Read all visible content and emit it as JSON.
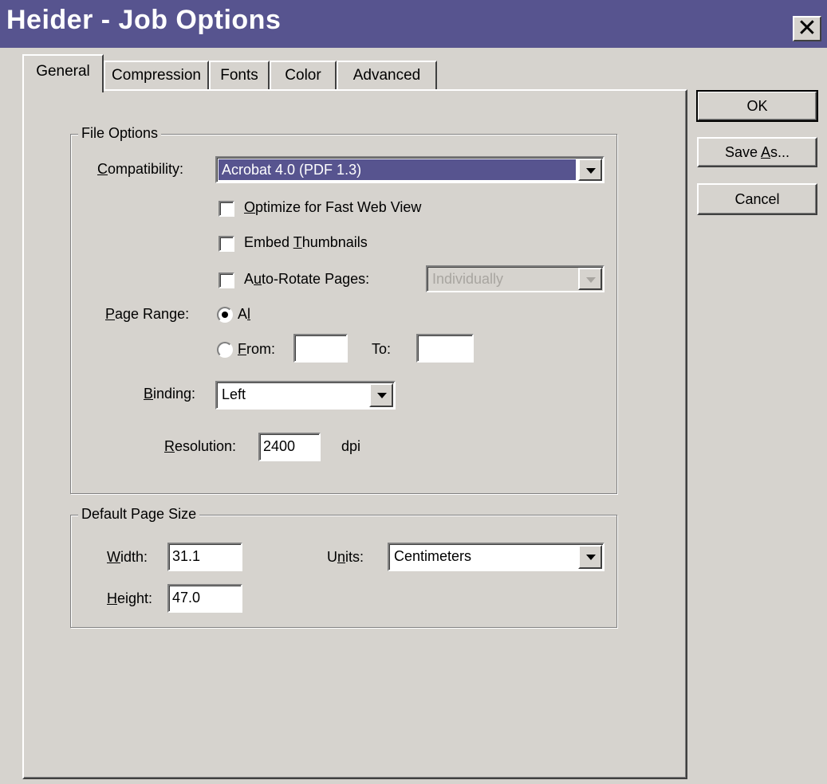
{
  "window": {
    "title": "Heider - Job Options",
    "close_glyph": "✕"
  },
  "tabs": [
    {
      "label": "General",
      "active": true
    },
    {
      "label": "Compression",
      "active": false
    },
    {
      "label": "Fonts",
      "active": false
    },
    {
      "label": "Color",
      "active": false
    },
    {
      "label": "Advanced",
      "active": false
    }
  ],
  "file_options": {
    "legend": "File Options",
    "compatibility": {
      "label_mnemonic": "C",
      "label_rest": "ompatibility:",
      "value": "Acrobat 4.0 (PDF 1.3)"
    },
    "optimize": {
      "checked": false,
      "label_mnemonic": "O",
      "label_rest": "ptimize for Fast Web View"
    },
    "thumbnails": {
      "checked": false,
      "label_pre": "Embed ",
      "label_mnemonic": "T",
      "label_rest": "humbnails"
    },
    "auto_rotate": {
      "checked": false,
      "label_pre": "A",
      "label_mnemonic": "u",
      "label_rest": "to-Rotate Pages:",
      "value": "Individually",
      "enabled": false
    },
    "page_range": {
      "label_mnemonic": "P",
      "label_rest": "age Range:",
      "all": {
        "selected": true,
        "label_pre": "A",
        "label_mnemonic": "l",
        "label_rest": "l"
      },
      "from": {
        "selected": false,
        "label_mnemonic": "F",
        "label_rest": "rom:",
        "value": ""
      },
      "to": {
        "label": "To:",
        "value": ""
      }
    },
    "binding": {
      "label_mnemonic": "B",
      "label_rest": "inding:",
      "value": "Left"
    },
    "resolution": {
      "label_mnemonic": "R",
      "label_rest": "esolution:",
      "value": "2400",
      "unit": "dpi"
    }
  },
  "page_size": {
    "legend": "Default Page Size",
    "width": {
      "label_mnemonic": "W",
      "label_rest": "idth:",
      "value": "31.1"
    },
    "height": {
      "label_mnemonic": "H",
      "label_rest": "eight:",
      "value": "47.0"
    },
    "units": {
      "label_pre": "U",
      "label_mnemonic": "n",
      "label_rest": "its:",
      "value": "Centimeters"
    }
  },
  "buttons": {
    "ok": "OK",
    "save_as_pre": "Save ",
    "save_as_mnemonic": "A",
    "save_as_rest": "s...",
    "cancel": "Cancel"
  },
  "colors": {
    "title_bar": "#57548f",
    "face": "#d6d3ce",
    "selection": "#57548f"
  }
}
